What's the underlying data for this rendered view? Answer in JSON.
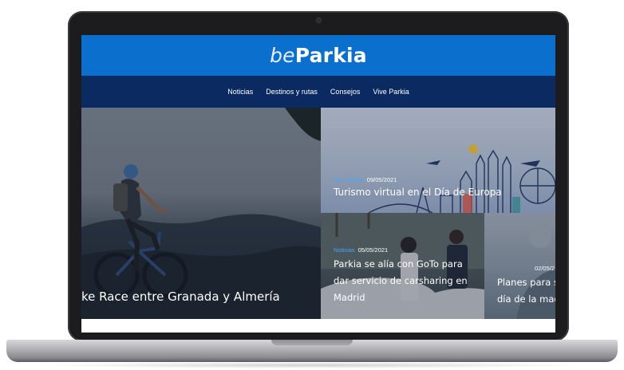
{
  "site": {
    "logo_prefix": "be",
    "logo_name": "Parkia",
    "brand_color": "#0b6fce",
    "nav_color": "#0a2a61"
  },
  "nav": {
    "items": [
      "Noticias",
      "Destinos y rutas",
      "Consejos",
      "Vive Parkia"
    ]
  },
  "articles": [
    {
      "title": "ke Race entre Granada y Almería"
    },
    {
      "category": "Vive Parkia",
      "date": "09/05/2021",
      "title": "Turismo virtual en el Día de Europa"
    },
    {
      "category": "Noticias",
      "date": "05/05/2021",
      "title_lines": [
        "Parkia se alía con GoTo para",
        "dar servicio de carsharing en",
        "Madrid"
      ]
    },
    {
      "date": "02/05/2",
      "title_lines": [
        "Planes para s",
        "día de la mad"
      ]
    }
  ]
}
